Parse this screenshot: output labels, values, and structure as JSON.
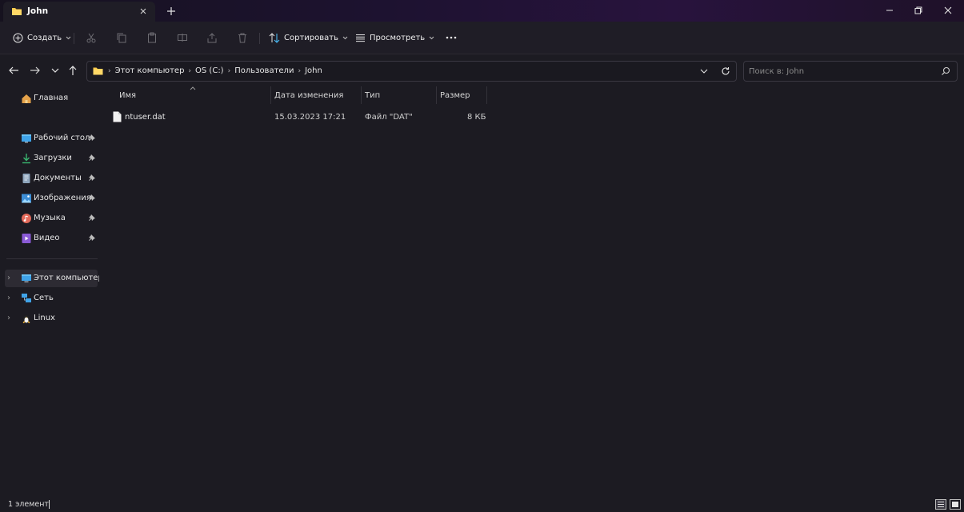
{
  "tab": {
    "title": "John"
  },
  "commands": {
    "create": "Создать",
    "sort": "Сортировать",
    "view": "Просмотреть"
  },
  "breadcrumb": [
    "Этот компьютер",
    "OS (C:)",
    "Пользователи",
    "John"
  ],
  "search": {
    "placeholder": "Поиск в: John"
  },
  "sidebar": {
    "home": "Главная",
    "quick": [
      {
        "label": "Рабочий стол",
        "icon": "desktop-icon"
      },
      {
        "label": "Загрузки",
        "icon": "downloads-icon"
      },
      {
        "label": "Документы",
        "icon": "documents-icon"
      },
      {
        "label": "Изображения",
        "icon": "pictures-icon"
      },
      {
        "label": "Музыка",
        "icon": "music-icon"
      },
      {
        "label": "Видео",
        "icon": "videos-icon"
      }
    ],
    "tree": [
      {
        "label": "Этот компьютер",
        "icon": "computer-icon"
      },
      {
        "label": "Сеть",
        "icon": "network-icon"
      },
      {
        "label": "Linux",
        "icon": "linux-icon"
      }
    ]
  },
  "columns": [
    "Имя",
    "Дата изменения",
    "Тип",
    "Размер"
  ],
  "files": [
    {
      "name": "ntuser.dat",
      "modified": "15.03.2023 17:21",
      "type": "Файл \"DAT\"",
      "size": "8 КБ"
    }
  ],
  "status": {
    "count": "1 элемент"
  },
  "colors": {
    "accent": "#4cc2ff",
    "folder": "#f8c84a",
    "background": "#1c1b22"
  }
}
